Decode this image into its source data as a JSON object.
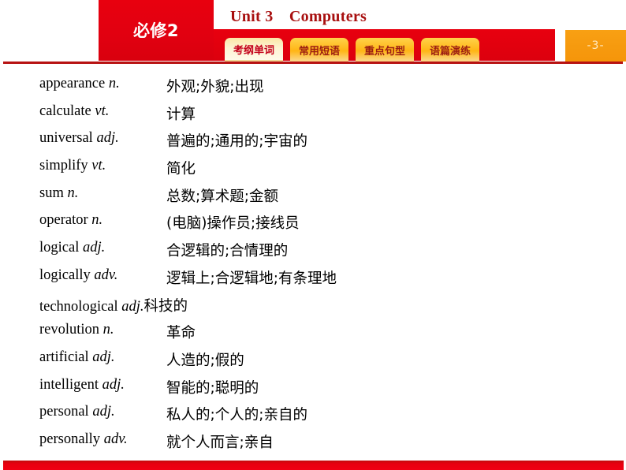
{
  "header": {
    "module_badge": "必修2",
    "title": "Unit 3 Computers",
    "page_number": "-3-",
    "tabs": [
      {
        "label": "考纲单词",
        "active": true
      },
      {
        "label": "常用短语",
        "active": false
      },
      {
        "label": "重点句型",
        "active": false
      },
      {
        "label": "语篇演练",
        "active": false
      }
    ]
  },
  "colors": {
    "brand_red": "#e60012",
    "title_red": "#a80f0f",
    "tab_active_text": "#c3001a",
    "tab_inactive_bg": "#ffb515",
    "page_box_orange": "#f59a0b"
  },
  "word_list": [
    {
      "word": "appearance ",
      "pos": "n.",
      "definition": "外观;外貌;出现",
      "inline": false
    },
    {
      "word": "calculate ",
      "pos": "vt.",
      "definition": "计算",
      "inline": false
    },
    {
      "word": "universal ",
      "pos": "adj.",
      "definition": "普遍的;通用的;宇宙的",
      "inline": false
    },
    {
      "word": "simplify ",
      "pos": "vt.",
      "definition": "简化",
      "inline": false
    },
    {
      "word": "sum ",
      "pos": "n.",
      "definition": "总数;算术题;金额",
      "inline": false
    },
    {
      "word": "operator ",
      "pos": "n.",
      "definition": "(电脑)操作员;接线员",
      "inline": false
    },
    {
      "word": "logical ",
      "pos": "adj.",
      "definition": "合逻辑的;合情理的",
      "inline": false
    },
    {
      "word": "logically ",
      "pos": "adv.",
      "definition": "逻辑上;合逻辑地;有条理地",
      "inline": false
    },
    {
      "word": "technological ",
      "pos": "adj.",
      "definition": "科技的",
      "inline": true
    },
    {
      "word": "revolution ",
      "pos": "n.",
      "definition": "革命",
      "inline": false
    },
    {
      "word": "artificial ",
      "pos": "adj.",
      "definition": "人造的;假的",
      "inline": false
    },
    {
      "word": "intelligent ",
      "pos": "adj.",
      "definition": "智能的;聪明的",
      "inline": false
    },
    {
      "word": "personal ",
      "pos": "adj.",
      "definition": "私人的;个人的;亲自的",
      "inline": false
    },
    {
      "word": "personally ",
      "pos": "adv.",
      "definition": "就个人而言;亲自",
      "inline": false
    }
  ]
}
